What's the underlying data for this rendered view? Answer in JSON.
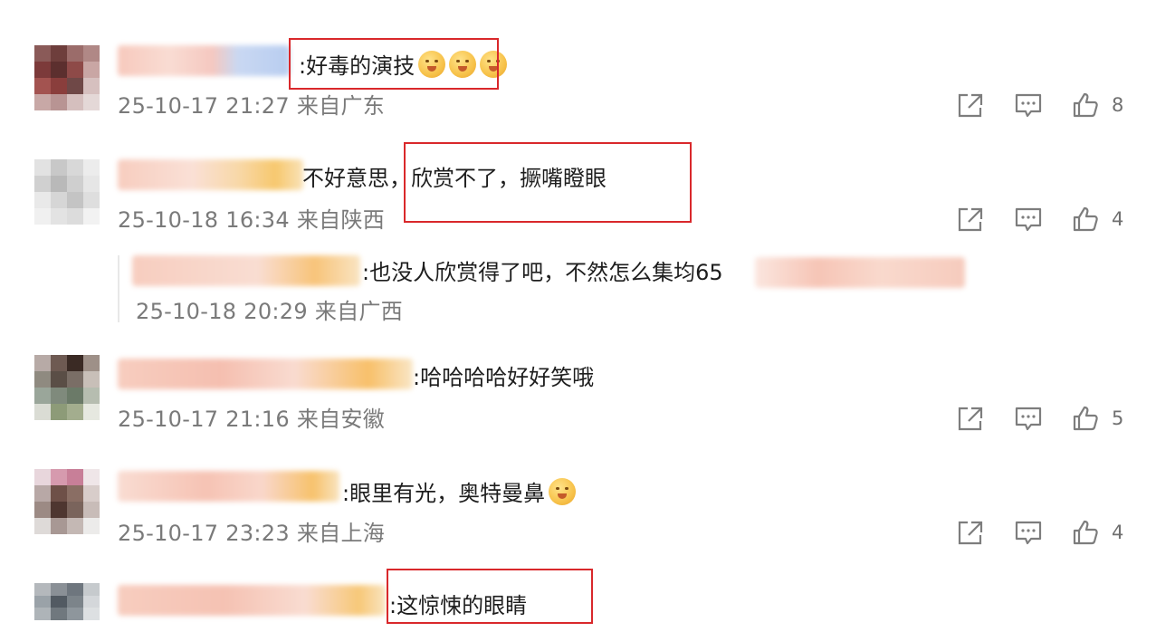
{
  "comments": [
    {
      "text": ":好毒的演技",
      "emoji_count": 3,
      "meta": "25-10-17 21:27 来自广东",
      "likes": "8"
    },
    {
      "text_prefix": "不好意思，",
      "text_highlight": "欣赏不了，撅嘴瞪眼",
      "meta": "25-10-18 16:34 来自陕西",
      "likes": "4",
      "reply": {
        "text": ":也没人欣赏得了吧，不然怎么集均65",
        "meta": "25-10-18 20:29 来自广西"
      }
    },
    {
      "text": ":哈哈哈哈好好笑哦",
      "meta": "25-10-17 21:16 来自安徽",
      "likes": "5"
    },
    {
      "text": ":眼里有光，奥特曼鼻",
      "emoji_count": 1,
      "meta": "25-10-17 23:23 来自上海",
      "likes": "4"
    },
    {
      "text": ":这惊悚的眼睛"
    }
  ],
  "icons": {
    "share": "share-icon",
    "comment": "comment-icon",
    "like": "thumbs-up-icon"
  },
  "colors": {
    "highlight_box": "#d9282b",
    "meta_text": "#7a7a7a",
    "action_icon": "#7d7d7d"
  }
}
